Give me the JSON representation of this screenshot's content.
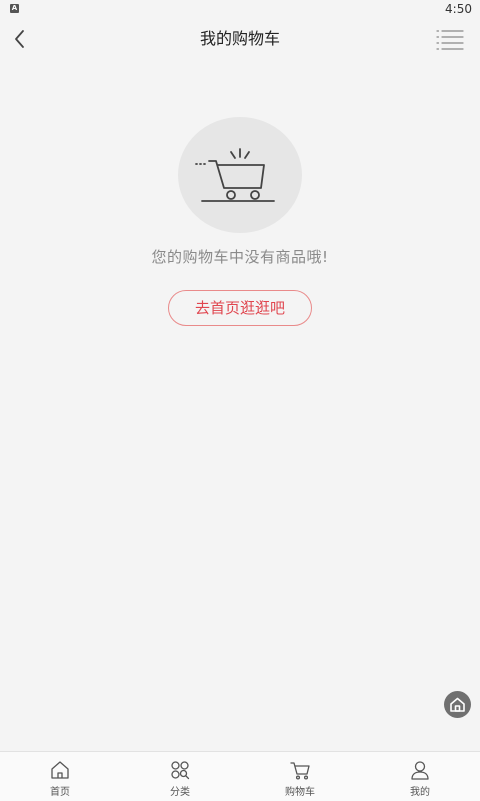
{
  "status_bar": {
    "time": "4:50",
    "app_icon_letter": "A"
  },
  "header": {
    "title": "我的购物车"
  },
  "empty_state": {
    "message": "您的购物车中没有商品哦!",
    "button_label": "去首页逛逛吧"
  },
  "tab_bar": {
    "items": [
      {
        "label": "首页",
        "icon": "home-icon"
      },
      {
        "label": "分类",
        "icon": "category-icon"
      },
      {
        "label": "购物车",
        "icon": "cart-icon"
      },
      {
        "label": "我的",
        "icon": "user-icon"
      }
    ]
  },
  "colors": {
    "background": "#f4f4f4",
    "accent": "#e0464f",
    "accent_border": "#e98a8a",
    "muted_text": "#8a8a8a"
  }
}
